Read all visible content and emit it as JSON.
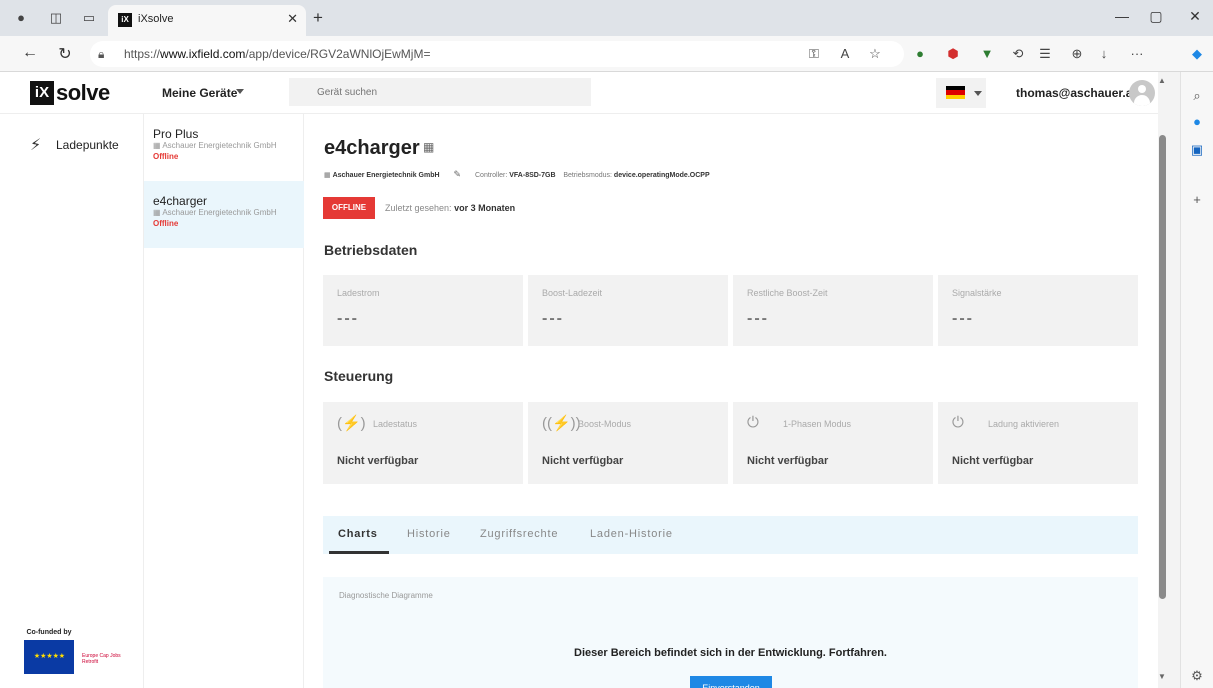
{
  "browser": {
    "tab_title": "iXsolve",
    "tab_favicon_text": "iX",
    "url_prefix": "https://",
    "url_domain": "www.ixfield.com",
    "url_path": "/app/device/RGV2aWNlOjEwMjM=",
    "minimize_glyph": "—",
    "restore_glyph": "▢",
    "close_glyph": "✕",
    "more_glyph": "···",
    "new_tab_glyph": "+"
  },
  "app": {
    "logo_mark": "iX",
    "logo_text": "solve",
    "devices_menu_label": "Meine Geräte",
    "search_placeholder": "Gerät suchen",
    "language_flag_colors": [
      "#000000",
      "#dd0000",
      "#ffce00"
    ],
    "user_email": "thomas@aschauer.at"
  },
  "left_nav": {
    "items": [
      {
        "label": "Ladepunkte",
        "icon": "charging-station-icon"
      }
    ],
    "eu": {
      "caption": "Co-funded by",
      "flag_stars": "★ ★ ★ ★ ★",
      "partner_text": "Europe Cap Jobs Retrofit"
    }
  },
  "device_list": {
    "items": [
      {
        "name": "Pro Plus",
        "company": "Aschauer Energietechnik GmbH",
        "status": "Offline",
        "selected": false
      },
      {
        "name": "e4charger",
        "company": "Aschauer Energietechnik GmbH",
        "status": "Offline",
        "selected": true
      }
    ]
  },
  "device": {
    "name": "e4charger",
    "company": "Aschauer Energietechnik GmbH",
    "controller_label": "Controller:",
    "controller_value": "VFA-8SD-7GB",
    "mode_label": "Betriebsmodus:",
    "mode_value": "device.operatingMode.OCPP",
    "status_badge": "OFFLINE",
    "last_seen_label": "Zuletzt gesehen:",
    "last_seen_value": "vor 3 Monaten",
    "accent_color": "#e53935"
  },
  "operating_data": {
    "title": "Betriebsdaten",
    "cards": [
      {
        "label": "Ladestrom",
        "value": "---"
      },
      {
        "label": "Boost-Ladezeit",
        "value": "---"
      },
      {
        "label": "Restliche Boost-Zeit",
        "value": "---"
      },
      {
        "label": "Signalstärke",
        "value": "---"
      }
    ]
  },
  "control": {
    "title": "Steuerung",
    "cards": [
      {
        "label": "Ladestatus",
        "value": "Nicht verfügbar",
        "icon": "charging-status-icon"
      },
      {
        "label": "Boost-Modus",
        "value": "Nicht verfügbar",
        "icon": "boost-mode-icon"
      },
      {
        "label": "1-Phasen Modus",
        "value": "Nicht verfügbar",
        "icon": "plug-icon"
      },
      {
        "label": "Ladung aktivieren",
        "value": "Nicht verfügbar",
        "icon": "plug-icon"
      }
    ]
  },
  "tabs": {
    "items": [
      "Charts",
      "Historie",
      "Zugriffsrechte",
      "Laden-Historie"
    ],
    "active": "Charts"
  },
  "diagnostics": {
    "title": "Diagnostische Diagramme",
    "message": "Dieser Bereich befindet sich in der Entwicklung. Fortfahren.",
    "button_label": "Einverstanden"
  }
}
